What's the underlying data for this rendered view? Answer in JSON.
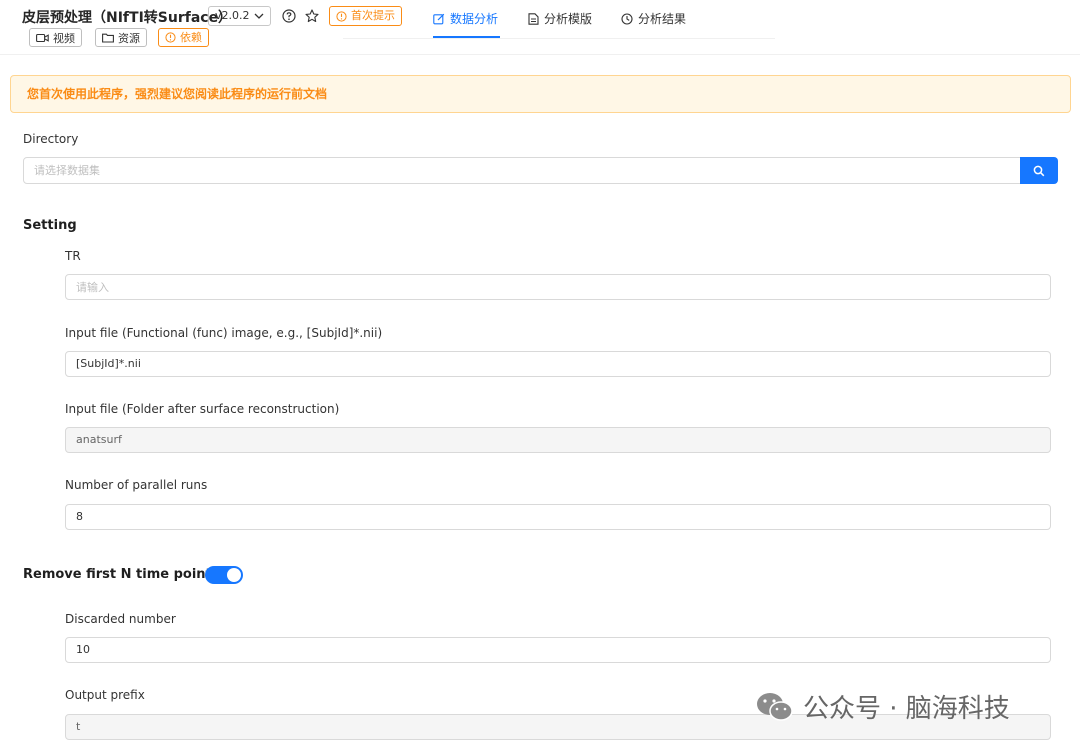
{
  "header": {
    "title": "皮层预处理（NIfTI转Surface）",
    "version": "v2.0.2",
    "first_tip": "首次提示",
    "tags": {
      "video": "视频",
      "resource": "资源",
      "dependency": "依赖"
    }
  },
  "tabs": [
    {
      "label": "数据分析",
      "icon": "edit-icon",
      "active": true
    },
    {
      "label": "分析模版",
      "icon": "file-icon",
      "active": false
    },
    {
      "label": "分析结果",
      "icon": "history-icon",
      "active": false
    }
  ],
  "alert": {
    "text": "您首次使用此程序，强烈建议您阅读此程序的运行前文档"
  },
  "directory": {
    "label": "Directory",
    "placeholder": "请选择数据集"
  },
  "setting": {
    "title": "Setting",
    "tr": {
      "label": "TR",
      "placeholder": "请输入",
      "value": ""
    },
    "func_input": {
      "label": "Input file (Functional (func) image, e.g., [SubjId]*.nii)",
      "value": "[SubjId]*.nii"
    },
    "surf_input": {
      "label": "Input file (Folder after surface reconstruction)",
      "value": "anatsurf"
    },
    "parallel": {
      "label": "Number of parallel runs",
      "value": "8"
    }
  },
  "remove": {
    "title": "Remove first N time points",
    "enabled": true,
    "discarded": {
      "label": "Discarded number",
      "value": "10"
    },
    "prefix": {
      "label": "Output prefix",
      "value": "t"
    }
  },
  "watermark": {
    "text": "公众号 · 脑海科技"
  },
  "colors": {
    "primary": "#1677ff",
    "warning": "#fa8c16",
    "alert_bg": "#fff7e6"
  }
}
